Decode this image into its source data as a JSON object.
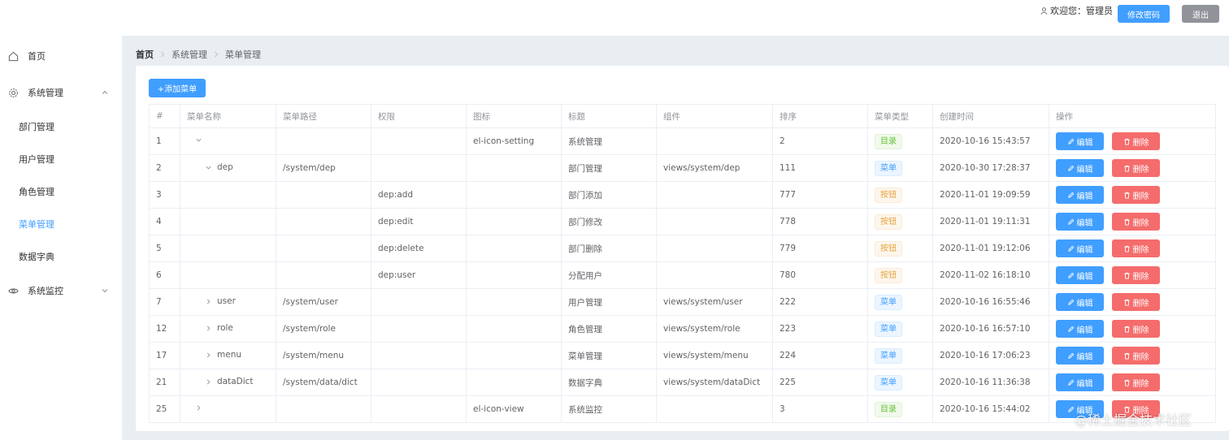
{
  "header": {
    "user_label": "欢迎您：管理员",
    "change_password": "修改密码",
    "logout": "退出"
  },
  "sidebar": {
    "home": "首页",
    "system": "系统管理",
    "dept": "部门管理",
    "users": "用户管理",
    "roles": "角色管理",
    "menus": "菜单管理",
    "dict": "数据字典",
    "monitor": "系统监控"
  },
  "breadcrumb": [
    "首页",
    "系统管理",
    "菜单管理"
  ],
  "toolbar": {
    "add_label": "+添加菜单"
  },
  "table": {
    "headers": [
      "#",
      "菜单名称",
      "菜单路径",
      "权限",
      "图标",
      "标题",
      "组件",
      "排序",
      "菜单类型",
      "创建时间",
      "操作"
    ],
    "edit_label": "编辑",
    "delete_label": "删除",
    "rows": [
      {
        "id": "1",
        "name": "",
        "path": "",
        "perm": "",
        "icon": "el-icon-setting",
        "title": "系统管理",
        "comp": "",
        "sort": "2",
        "type": "目录",
        "tag": "dir",
        "created": "2020-10-16 15:43:57",
        "level": 0,
        "expanded": true
      },
      {
        "id": "2",
        "name": "dep",
        "path": "/system/dep",
        "perm": "",
        "icon": "",
        "title": "部门管理",
        "comp": "views/system/dep",
        "sort": "111",
        "type": "菜单",
        "tag": "menu",
        "created": "2020-10-30 17:28:37",
        "level": 1,
        "expanded": true
      },
      {
        "id": "3",
        "name": "",
        "path": "",
        "perm": "dep:add",
        "icon": "",
        "title": "部门添加",
        "comp": "",
        "sort": "777",
        "type": "按钮",
        "tag": "btn",
        "created": "2020-11-01 19:09:59",
        "level": 2,
        "expanded": null
      },
      {
        "id": "4",
        "name": "",
        "path": "",
        "perm": "dep:edit",
        "icon": "",
        "title": "部门修改",
        "comp": "",
        "sort": "778",
        "type": "按钮",
        "tag": "btn",
        "created": "2020-11-01 19:11:31",
        "level": 2,
        "expanded": null
      },
      {
        "id": "5",
        "name": "",
        "path": "",
        "perm": "dep:delete",
        "icon": "",
        "title": "部门删除",
        "comp": "",
        "sort": "779",
        "type": "按钮",
        "tag": "btn",
        "created": "2020-11-01 19:12:06",
        "level": 2,
        "expanded": null
      },
      {
        "id": "6",
        "name": "",
        "path": "",
        "perm": "dep:user",
        "icon": "",
        "title": "分配用户",
        "comp": "",
        "sort": "780",
        "type": "按钮",
        "tag": "btn",
        "created": "2020-11-02 16:18:10",
        "level": 2,
        "expanded": null
      },
      {
        "id": "7",
        "name": "user",
        "path": "/system/user",
        "perm": "",
        "icon": "",
        "title": "用户管理",
        "comp": "views/system/user",
        "sort": "222",
        "type": "菜单",
        "tag": "menu",
        "created": "2020-10-16 16:55:46",
        "level": 1,
        "expanded": false
      },
      {
        "id": "12",
        "name": "role",
        "path": "/system/role",
        "perm": "",
        "icon": "",
        "title": "角色管理",
        "comp": "views/system/role",
        "sort": "223",
        "type": "菜单",
        "tag": "menu",
        "created": "2020-10-16 16:57:10",
        "level": 1,
        "expanded": false
      },
      {
        "id": "17",
        "name": "menu",
        "path": "/system/menu",
        "perm": "",
        "icon": "",
        "title": "菜单管理",
        "comp": "views/system/menu",
        "sort": "224",
        "type": "菜单",
        "tag": "menu",
        "created": "2020-10-16 17:06:23",
        "level": 1,
        "expanded": false
      },
      {
        "id": "21",
        "name": "dataDict",
        "path": "/system/data/dict",
        "perm": "",
        "icon": "",
        "title": "数据字典",
        "comp": "views/system/dataDict",
        "sort": "225",
        "type": "菜单",
        "tag": "menu",
        "created": "2020-10-16 11:36:38",
        "level": 1,
        "expanded": false
      },
      {
        "id": "25",
        "name": "",
        "path": "",
        "perm": "",
        "icon": "el-icon-view",
        "title": "系统监控",
        "comp": "",
        "sort": "3",
        "type": "目录",
        "tag": "dir",
        "created": "2020-10-16 15:44:02",
        "level": 0,
        "expanded": false
      }
    ]
  },
  "watermark": "@稀土掘金技术社区"
}
